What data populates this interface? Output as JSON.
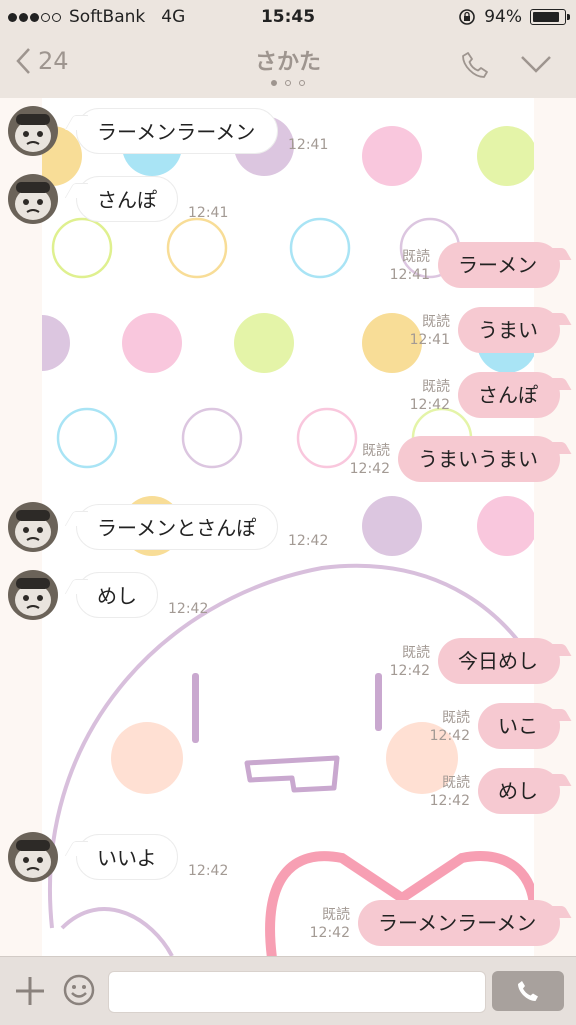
{
  "status_bar": {
    "signal_dots": [
      "filled",
      "filled",
      "filled",
      "empty",
      "empty"
    ],
    "carrier": "SoftBank",
    "network": "4G",
    "time": "15:45",
    "battery_percent": "94%",
    "battery_level": 0.94,
    "icons": [
      "rotation-lock-icon",
      "battery-icon"
    ]
  },
  "header": {
    "back_count": "24",
    "title": "さかた",
    "pager_dots": 3,
    "active_page": 0,
    "icons": [
      "chevron-left-icon",
      "phone-icon",
      "chevron-down-icon"
    ]
  },
  "messages": [
    {
      "side": "in",
      "text": "ラーメンラーメン",
      "time": "12:41"
    },
    {
      "side": "in",
      "text": "さんぽ",
      "time": "12:41"
    },
    {
      "side": "out",
      "text": "ラーメン",
      "read": "既読",
      "time": "12:41"
    },
    {
      "side": "out",
      "text": "うまい",
      "read": "既読",
      "time": "12:41"
    },
    {
      "side": "out",
      "text": "さんぽ",
      "read": "既読",
      "time": "12:42"
    },
    {
      "side": "out",
      "text": "うまいうまい",
      "read": "既読",
      "time": "12:42"
    },
    {
      "side": "in",
      "text": "ラーメンとさんぽ",
      "time": "12:42"
    },
    {
      "side": "in",
      "text": "めし",
      "time": "12:42"
    },
    {
      "side": "out",
      "text": "今日めし",
      "read": "既読",
      "time": "12:42"
    },
    {
      "side": "out",
      "text": "いこ",
      "read": "既読",
      "time": "12:42"
    },
    {
      "side": "out",
      "text": "めし",
      "read": "既読",
      "time": "12:42"
    },
    {
      "side": "in",
      "text": "いいよ",
      "time": "12:42"
    },
    {
      "side": "out",
      "text": "ラーメンラーメン",
      "read": "既読",
      "time": "12:42"
    }
  ],
  "input_bar": {
    "icons": [
      "plus-icon",
      "emoji-icon",
      "phone-icon"
    ],
    "text_value": ""
  },
  "colors": {
    "header_bg": "#ece5df",
    "outgoing_bubble": "#f6c9d1",
    "incoming_bubble": "#ffffff",
    "muted_text": "#9e958f"
  }
}
